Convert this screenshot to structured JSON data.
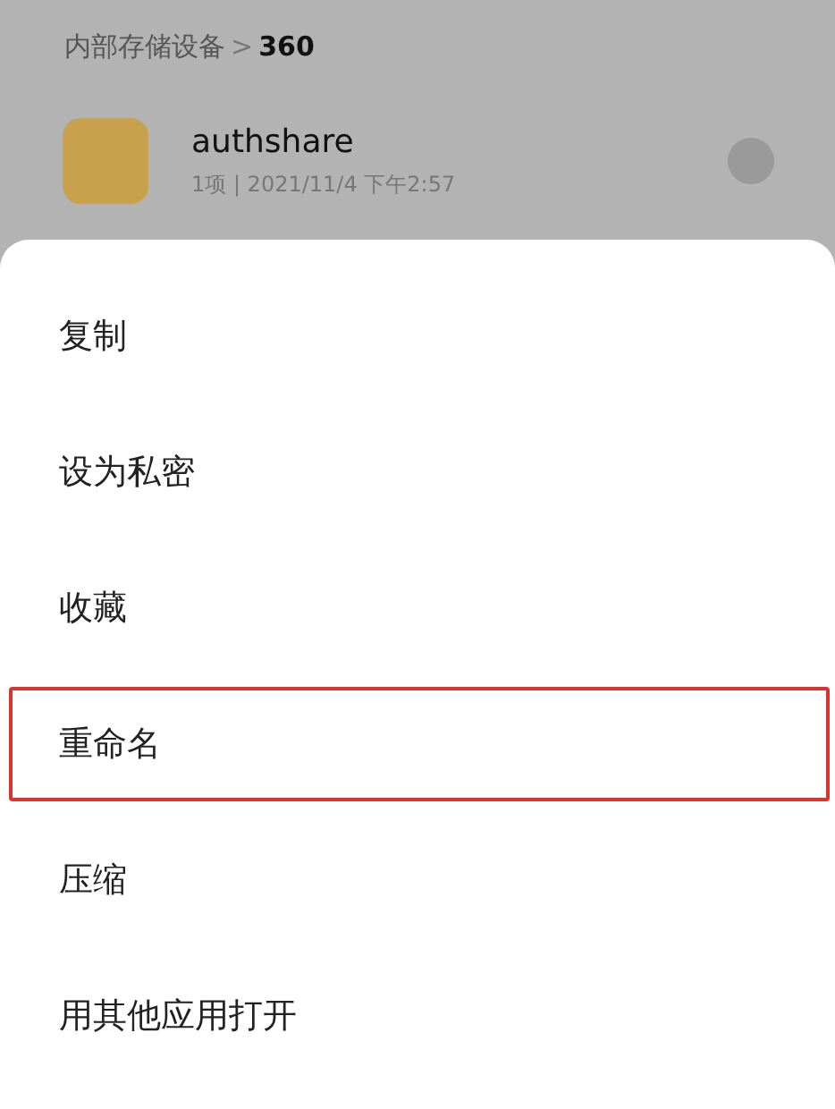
{
  "breadcrumb": {
    "parent": "内部存储设备",
    "separator": ">",
    "current": "360"
  },
  "file": {
    "name": "authshare",
    "meta": "1项 | 2021/11/4 下午2:57",
    "checked": false
  },
  "menu": [
    {
      "label": "复制",
      "highlighted": false
    },
    {
      "label": "设为私密",
      "highlighted": false
    },
    {
      "label": "收藏",
      "highlighted": false
    },
    {
      "label": "重命名",
      "highlighted": true
    },
    {
      "label": "压缩",
      "highlighted": false
    },
    {
      "label": "用其他应用打开",
      "highlighted": false
    }
  ]
}
